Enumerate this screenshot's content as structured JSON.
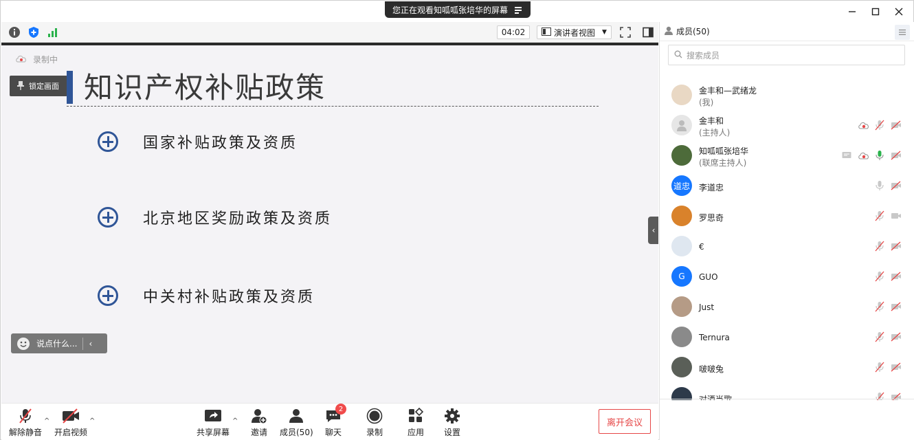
{
  "banner": {
    "text": "您正在观看知呱呱张培华的屏幕"
  },
  "topbar": {
    "timer": "04:02",
    "view_label": "演讲者视图"
  },
  "stage": {
    "recording_label": "录制中",
    "lock_label": "锁定画面",
    "slide_title": "知识产权补贴政策",
    "bullets": [
      "国家补贴政策及资质",
      "北京地区奖励政策及资质",
      "中关村补贴政策及资质"
    ],
    "chat_placeholder": "说点什么..."
  },
  "toolbar": {
    "unmute": "解除静音",
    "start_video": "开启视频",
    "share_screen": "共享屏幕",
    "invite": "邀请",
    "members": "成员(50)",
    "chat": "聊天",
    "chat_badge": "2",
    "record": "录制",
    "apps": "应用",
    "settings": "设置",
    "leave": "离开会议"
  },
  "panel": {
    "title": "成员(50)",
    "search_placeholder": "搜索成员",
    "members": [
      {
        "name": "金丰和—武绪龙",
        "role": "(我)",
        "avatar_text": "",
        "avatar_color": "#e9d8c4",
        "icons": []
      },
      {
        "name": "金丰和",
        "role": "(主持人)",
        "avatar_text": "",
        "avatar_color": "#e6e6e6",
        "icons": [
          "record-icon",
          "mic-off-icon",
          "video-off-icon"
        ]
      },
      {
        "name": "知呱呱张培华",
        "role": "(联席主持人)",
        "avatar_text": "",
        "avatar_color": "#4d6b3a",
        "icons": [
          "share-icon",
          "record-icon",
          "mic-on-icon",
          "video-off-icon"
        ]
      },
      {
        "name": "李道忠",
        "role": "",
        "avatar_text": "道忠",
        "avatar_color": "#1677ff",
        "icons": [
          "mic-gray-icon",
          "video-off-icon"
        ]
      },
      {
        "name": "罗思奇",
        "role": "",
        "avatar_text": "",
        "avatar_color": "#d9822b",
        "icons": [
          "mic-off-icon",
          "video-gray-icon"
        ]
      },
      {
        "name": "€",
        "role": "",
        "avatar_text": "",
        "avatar_color": "#dfe7f0",
        "icons": [
          "mic-off-icon",
          "video-off-icon"
        ]
      },
      {
        "name": "GUO",
        "role": "",
        "avatar_text": "G",
        "avatar_color": "#1677ff",
        "icons": [
          "mic-off-icon",
          "video-off-icon"
        ]
      },
      {
        "name": "Just",
        "role": "",
        "avatar_text": "",
        "avatar_color": "#b59b86",
        "icons": [
          "mic-off-icon",
          "video-off-icon"
        ]
      },
      {
        "name": "Ternura",
        "role": "",
        "avatar_text": "",
        "avatar_color": "#8a8a8a",
        "icons": [
          "mic-off-icon",
          "video-off-icon"
        ]
      },
      {
        "name": "啵啵兔",
        "role": "",
        "avatar_text": "",
        "avatar_color": "#5a5f58",
        "icons": [
          "mic-off-icon",
          "video-off-icon"
        ]
      },
      {
        "name": "对酒当歌",
        "role": "",
        "avatar_text": "",
        "avatar_color": "#2d3a4a",
        "icons": [
          "mic-off-icon",
          "video-off-icon"
        ]
      }
    ]
  },
  "colors": {
    "accent": "#2f5597",
    "danger": "#e64646",
    "brand_blue": "#1677ff"
  }
}
